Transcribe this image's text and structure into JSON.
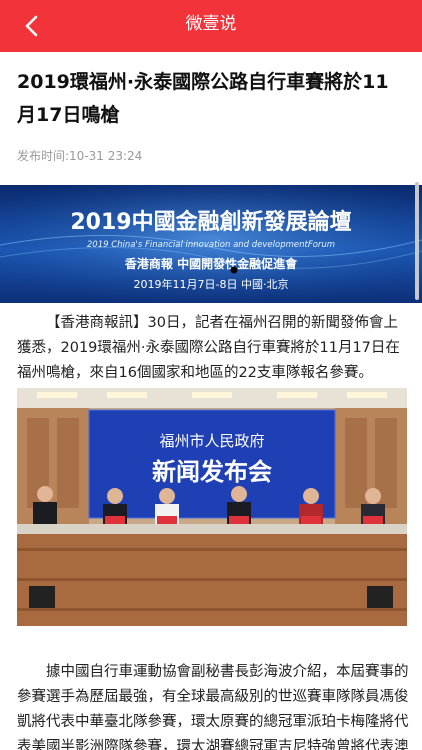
{
  "header": {
    "title": "微壹说",
    "back_icon": "chevron-left-icon"
  },
  "article": {
    "title": "2019環福州·永泰國際公路自行車賽將於11月17日鳴槍",
    "publish_time": "发布时间:10-31 23:24",
    "lead": "【香港商報訊】30日，記者在福州召開的新聞發佈會上獲悉，2019環福州·永泰國際公路自行車賽將於11月17日在福州鳴槍，來自16個國家和地區的22支車隊報名參賽。",
    "body": "據中國自行車運動協會副秘書長彭海波介紹，本屆賽事的參賽選手為歷屆最強，有全球最高級別的世巡賽車隊隊員馮俊凱將代表中華臺北隊參賽，環太原賽的總冠軍派珀卡梅隆將代表美國半影洲際隊參賽，環太湖賽總冠軍吉尼特強曾將代表澳"
  },
  "banner": {
    "title": "2019中國金融創新發展論壇",
    "subtitle_en": "2019 China's Financial innovation and developmentForum",
    "organizers": "香港商報  中國開發性金融促進會",
    "date_location": "2019年11月7日-8日  中國·北京"
  },
  "photo": {
    "backdrop_line1": "福州市人民政府",
    "backdrop_line2": "新闻发布会"
  },
  "colors": {
    "header_bg": "#f2343a",
    "banner_bg": "#12347a",
    "backdrop_bg": "#1f3fb5"
  }
}
